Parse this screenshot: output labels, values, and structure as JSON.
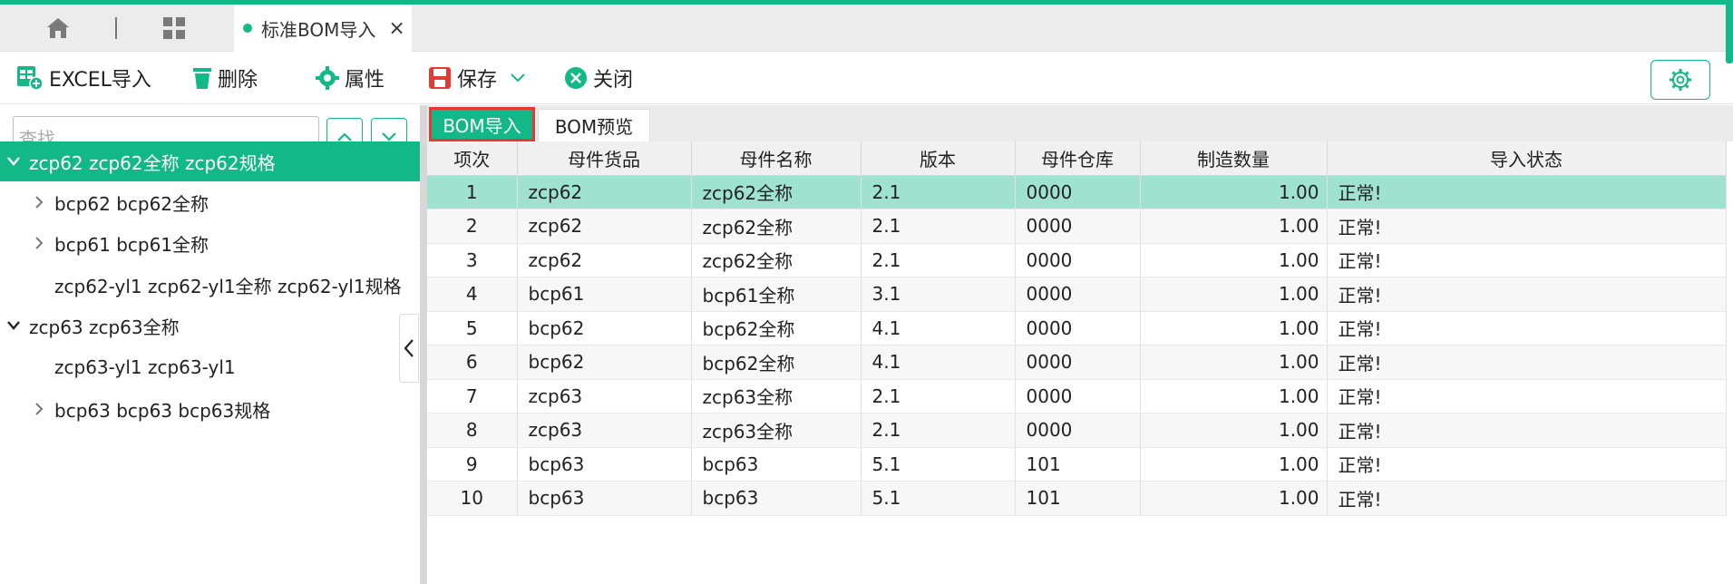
{
  "tabs": {
    "active_tab_label": "标准BOM导入",
    "close_symbol": "×"
  },
  "toolbar": {
    "excel_import": "EXCEL导入",
    "delete": "删除",
    "properties": "属性",
    "save": "保存",
    "close": "关闭"
  },
  "search": {
    "placeholder": "查找"
  },
  "tree": [
    {
      "label": "zcp62 zcp62全称 zcp62规格",
      "level": 0,
      "expanded": true,
      "selected": true
    },
    {
      "label": "bcp62 bcp62全称",
      "level": 1,
      "expandable": true
    },
    {
      "label": "bcp61 bcp61全称",
      "level": 1,
      "expandable": true
    },
    {
      "label": "zcp62-yl1 zcp62-yl1全称 zcp62-yl1规格",
      "level": 1,
      "expandable": false
    },
    {
      "label": "zcp63 zcp63全称",
      "level": 0,
      "expanded": true
    },
    {
      "label": "zcp63-yl1 zcp63-yl1",
      "level": 1,
      "expandable": false
    },
    {
      "label": "bcp63 bcp63 bcp63规格",
      "level": 1,
      "expandable": true
    }
  ],
  "subtabs": {
    "import": "BOM导入",
    "preview": "BOM预览"
  },
  "table": {
    "headers": [
      "项次",
      "母件货品",
      "母件名称",
      "版本",
      "母件仓库",
      "制造数量",
      "导入状态"
    ],
    "rows": [
      [
        "1",
        "zcp62",
        "zcp62全称",
        "2.1",
        "0000",
        "1.00",
        "正常!"
      ],
      [
        "2",
        "zcp62",
        "zcp62全称",
        "2.1",
        "0000",
        "1.00",
        "正常!"
      ],
      [
        "3",
        "zcp62",
        "zcp62全称",
        "2.1",
        "0000",
        "1.00",
        "正常!"
      ],
      [
        "4",
        "bcp61",
        "bcp61全称",
        "3.1",
        "0000",
        "1.00",
        "正常!"
      ],
      [
        "5",
        "bcp62",
        "bcp62全称",
        "4.1",
        "0000",
        "1.00",
        "正常!"
      ],
      [
        "6",
        "bcp62",
        "bcp62全称",
        "4.1",
        "0000",
        "1.00",
        "正常!"
      ],
      [
        "7",
        "zcp63",
        "zcp63全称",
        "2.1",
        "0000",
        "1.00",
        "正常!"
      ],
      [
        "8",
        "zcp63",
        "zcp63全称",
        "2.1",
        "0000",
        "1.00",
        "正常!"
      ],
      [
        "9",
        "bcp63",
        "bcp63",
        "5.1",
        "101",
        "1.00",
        "正常!"
      ],
      [
        "10",
        "bcp63",
        "bcp63",
        "5.1",
        "101",
        "1.00",
        "正常!"
      ]
    ]
  },
  "colors": {
    "accent": "#12b886",
    "highlight_row": "#9fe3cf",
    "active_tab_border": "#e53935"
  }
}
